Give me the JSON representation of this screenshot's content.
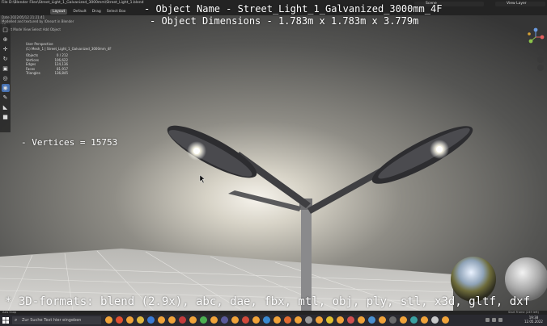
{
  "window": {
    "title_line1": "File D:\\Blender Files\\Street_Light_1_Galvanized_3000mm\\Street_Light_1.blend",
    "title_line2": "Date 2022/05/12 21:21:41"
  },
  "menu": {
    "items": [
      "File",
      "Edit",
      "Render",
      "Window",
      "Help"
    ],
    "workspace_tabs": [
      "Layout",
      "Default",
      "Drag",
      "Select Box"
    ],
    "active_tab": "Layout",
    "scene_label": "Scene",
    "view_layer_label": "View Layer"
  },
  "info_panel": {
    "line1": "Modelled and textured by lOneart in Blender 3D",
    "line2": "Object Mode  View  Select  Add  Object"
  },
  "stats": {
    "header": "User Perspective",
    "collection": "(1) Mesh_1 | Street_Light_1_Galvanized_3000mm_4F",
    "rows": [
      {
        "label": "Objects",
        "value": "0 / 212"
      },
      {
        "label": "Vertices",
        "value": "106,622"
      },
      {
        "label": "Edges",
        "value": "124,136"
      },
      {
        "label": "Faces",
        "value": "81,917"
      },
      {
        "label": "Triangles",
        "value": "136,845"
      }
    ]
  },
  "overlay": {
    "object_name": "- Object Name - Street_Light_1_Galvanized_3000mm_4F",
    "object_dimensions": "- Object Dimensions -  1.783m x 1.783m x 3.779m",
    "vertices": "- Vertices = 15753",
    "formats": "* 3D-formats: blend (2.9x), abc, dae, fbx, mtl, obj, ply, stl, x3d, gltf, dxf"
  },
  "statusbar": {
    "left": "Axis Snap",
    "right": "Start Frame (249 left)"
  },
  "taskbar": {
    "search_placeholder": "Zur Suche Text hier eingeben",
    "time": "19:38",
    "date": "12.05.2022"
  },
  "colors": {
    "accent": "#4772b3",
    "sky_center": "#f4f1ea",
    "sky_edge": "#3a3a3a"
  }
}
